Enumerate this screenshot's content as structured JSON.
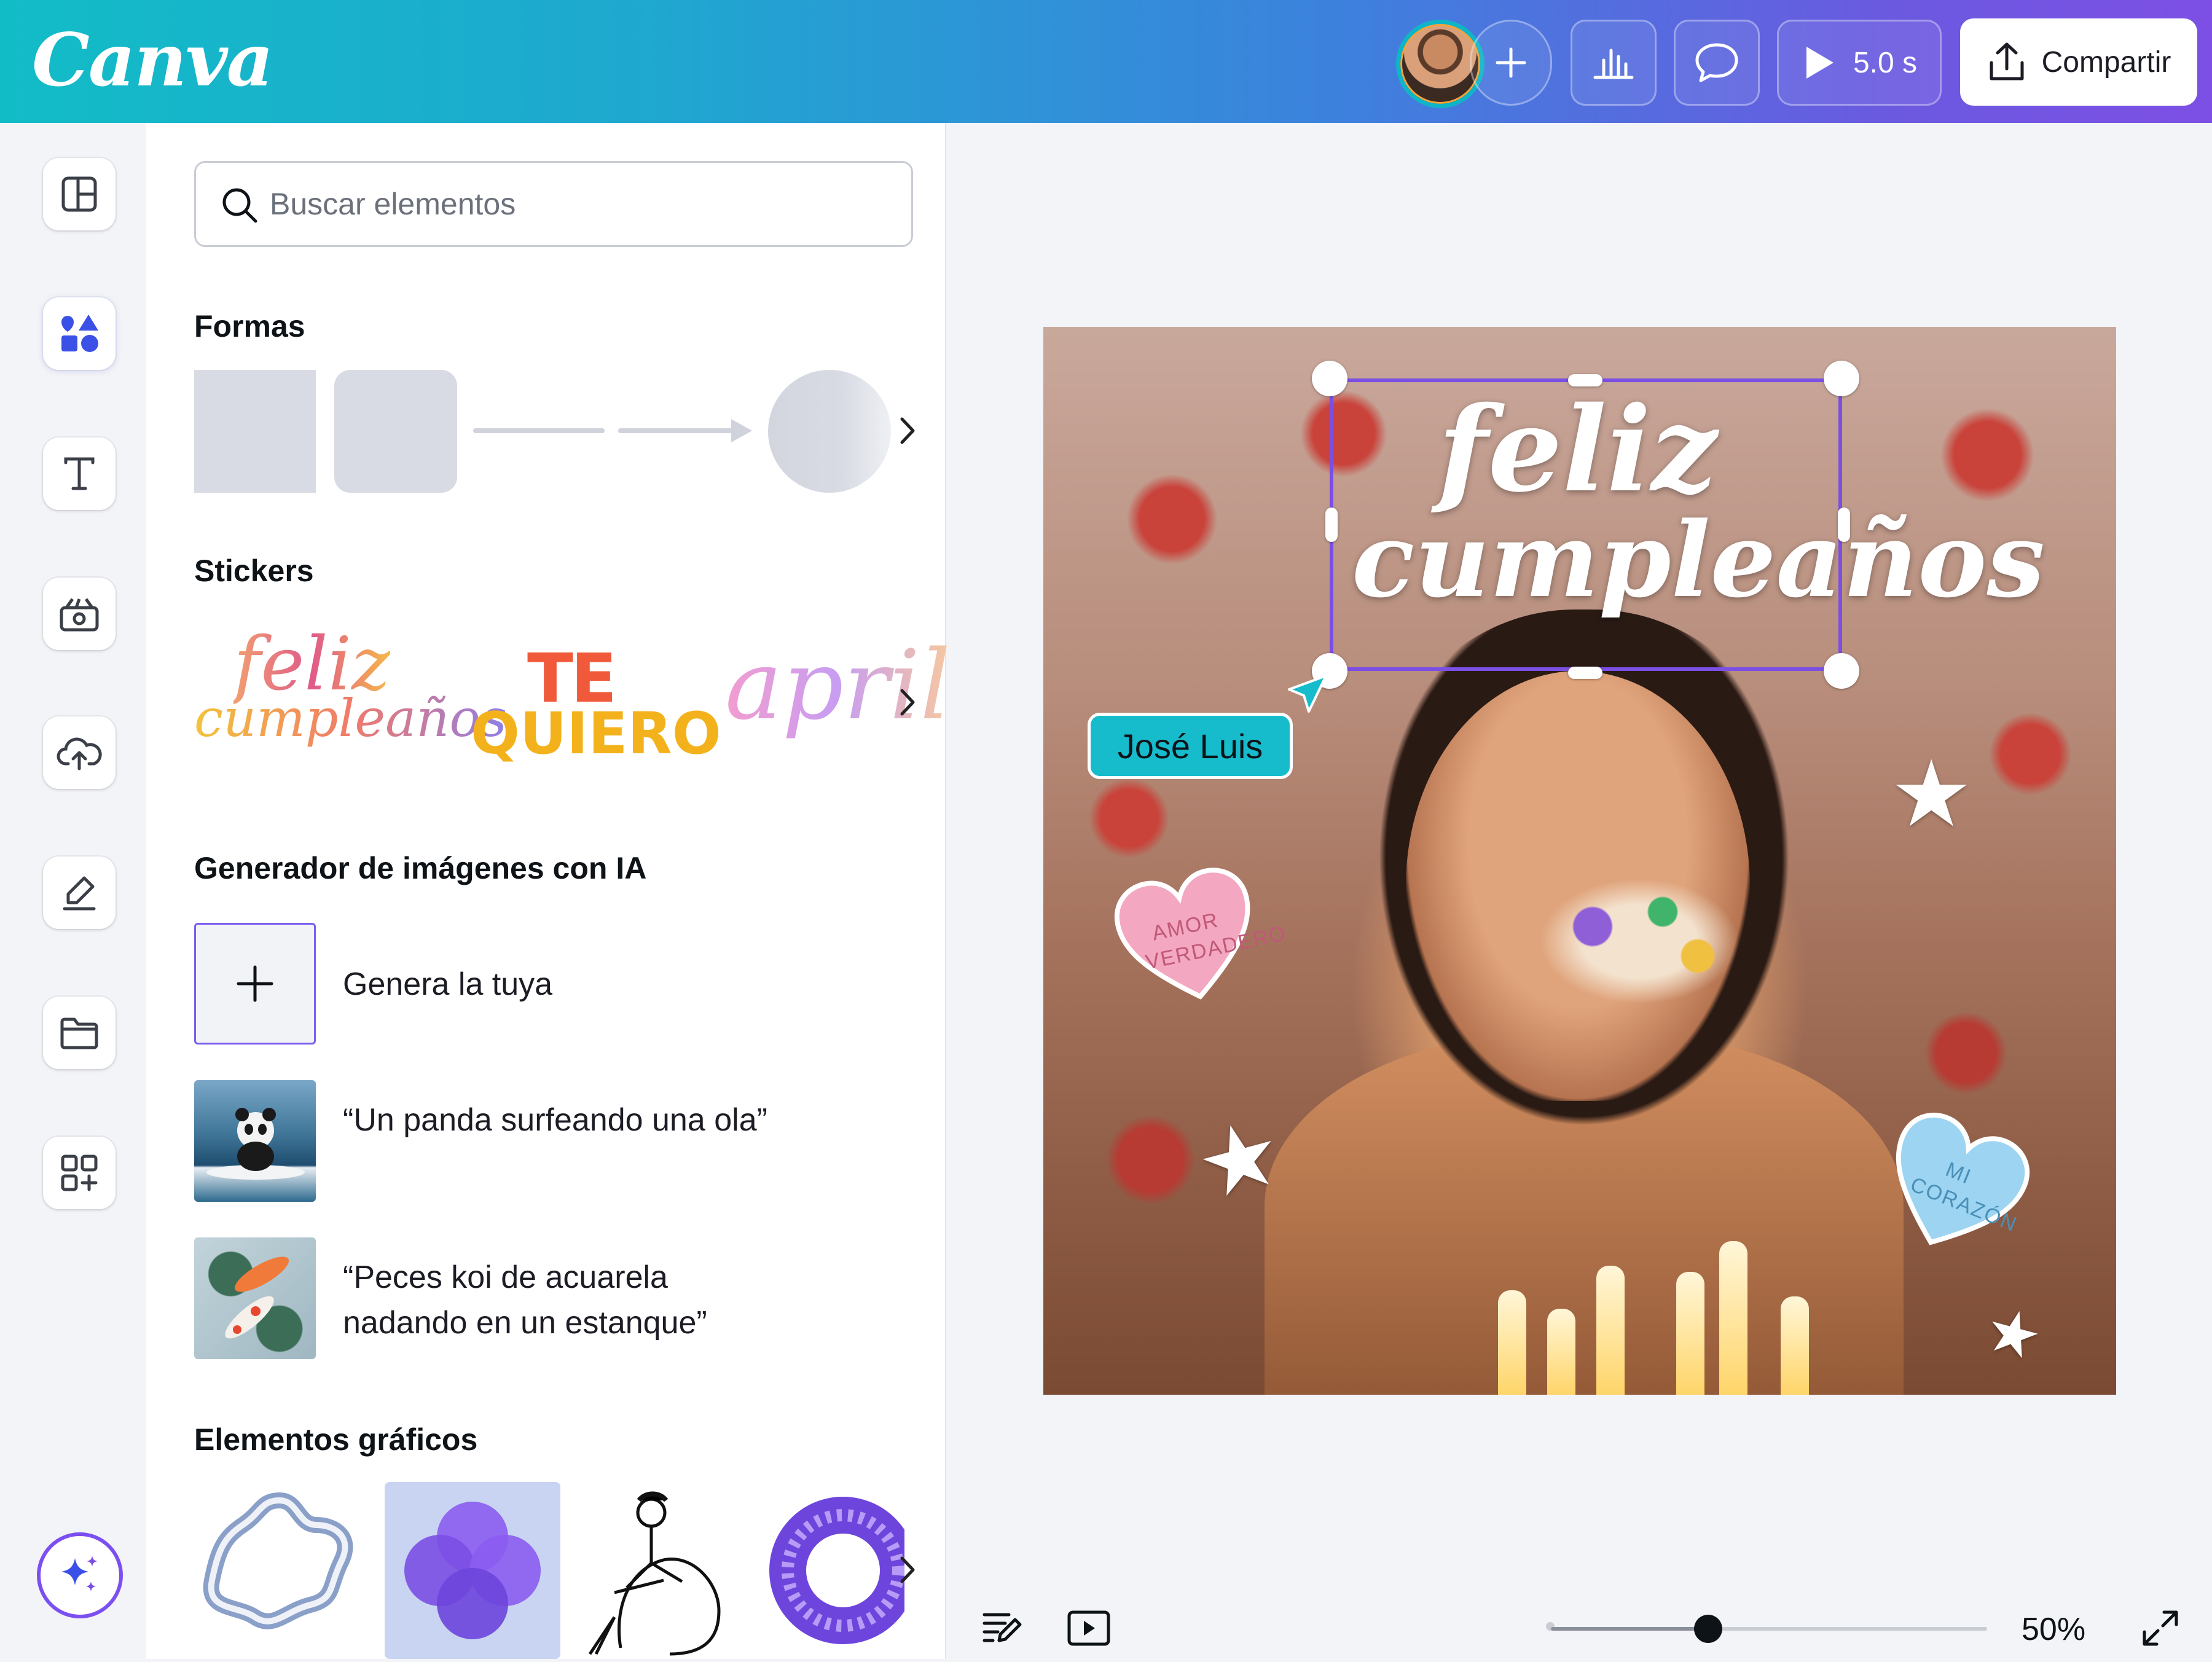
{
  "app": {
    "logo": "Canva",
    "accent_color": "#7b4fe4",
    "topbar_colors": [
      "#12bcc7",
      "#7d4fe4"
    ]
  },
  "topbar": {
    "avatar_icon": "user-avatar",
    "add_collaborator_icon": "plus-icon",
    "analytics_icon": "bar-chart-icon",
    "comment_icon": "comment-icon",
    "play_icon": "play-icon",
    "duration": "5.0 s",
    "share_label": "Compartir",
    "share_icon": "upload-icon"
  },
  "rail": {
    "items": [
      {
        "name": "templates",
        "icon": "layout-icon"
      },
      {
        "name": "elements",
        "icon": "shapes-icon",
        "active": true
      },
      {
        "name": "text",
        "icon": "text-icon"
      },
      {
        "name": "brand",
        "icon": "brand-kit-icon"
      },
      {
        "name": "uploads",
        "icon": "cloud-upload-icon"
      },
      {
        "name": "draw",
        "icon": "draw-icon"
      },
      {
        "name": "projects",
        "icon": "folder-icon"
      },
      {
        "name": "apps",
        "icon": "apps-icon"
      }
    ],
    "magic_icon": "sparkle-icon"
  },
  "panel": {
    "search_placeholder": "Buscar elementos",
    "shapes_title": "Formas",
    "stickers_title": "Stickers",
    "stickers": [
      {
        "line1": "feliz",
        "line2": "cumpleaños"
      },
      {
        "line1": "TE",
        "line2": "QUIERO"
      },
      {
        "line1": "april"
      }
    ],
    "ai_title": "Generador de imágenes con IA",
    "ai_generate_label": "Genera la tuya",
    "ai_prompts": [
      "“Un panda surfeando una ola”",
      "“Peces koi de acuarela nadando en un estanque”"
    ],
    "graphics_title": "Elementos gráficos"
  },
  "canvas": {
    "title_line1": "feliz",
    "title_line2": "cumpleaños",
    "collaborator_label": "José Luis",
    "heart1_text": "AMOR VERDADERO",
    "heart2_text": "MI CORAZÓN",
    "heart1_color": "#f4a7c0",
    "heart2_color": "#9cd4f2"
  },
  "bottombar": {
    "notes_icon": "notes-icon",
    "present_icon": "present-icon",
    "zoom_percent": 50,
    "zoom_label": "50%",
    "fullscreen_icon": "fullscreen-icon"
  }
}
